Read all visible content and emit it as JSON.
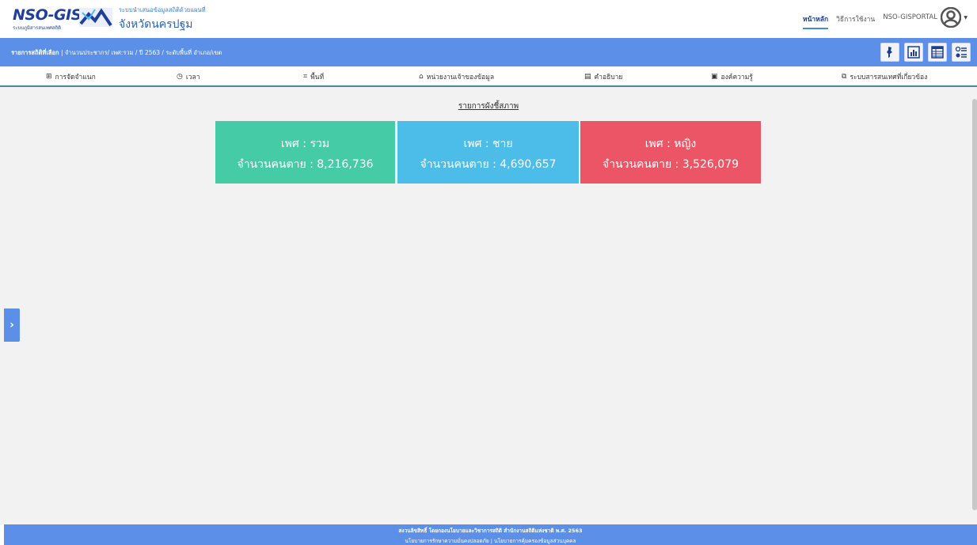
{
  "header": {
    "logo_text": "NSO-GIS",
    "logo_subtext": "ระบบภูมิสารสนเทศสถิติ",
    "site_subtitle": "ระบบนำเสนอข้อมูลสถิติด้วยแผนที่",
    "site_title": "จังหวัดนครปฐม",
    "nav": [
      "หน้าหลัก",
      "วิธีการใช้งาน",
      "NSO-GISPORTAL"
    ],
    "active_nav": "หน้าหลัก"
  },
  "breadcrumb": {
    "label": "รายการสถิติที่เลือก",
    "path": " | จำนวนประชากร/ เพศ:รวม / ปี 2563 / ระดับพื้นที่ อำเภอ/เขต"
  },
  "view_buttons": [
    "map-view-icon",
    "chart-view-icon",
    "table-view-icon",
    "list-view-icon"
  ],
  "menu": [
    {
      "label": "การจัดจำแนก",
      "icon": "sitemap-icon"
    },
    {
      "label": "เวลา",
      "icon": "clock-icon"
    },
    {
      "label": "พื้นที่",
      "icon": "area-icon"
    },
    {
      "label": "หน่วยงานเจ้าของข้อมูล",
      "icon": "institution-icon"
    },
    {
      "label": "คำอธิบาย",
      "icon": "description-icon"
    },
    {
      "label": "องค์ความรู้",
      "icon": "knowledge-icon"
    },
    {
      "label": "ระบบสารสนเทศที่เกี่ยวข้อง",
      "icon": "related-systems-icon"
    }
  ],
  "main": {
    "section_title": "รายการผังชี้สภาพ",
    "cards": [
      {
        "line1": "เพศ : รวม",
        "line2": "จำนวนคนตาย : 8,216,736",
        "color": "#45cba6"
      },
      {
        "line1": "เพศ : ชาย",
        "line2": "จำนวนคนตาย : 4,690,657",
        "color": "#4cbde8"
      },
      {
        "line1": "เพศ : หญิง",
        "line2": "จำนวนคนตาย : 3,526,079",
        "color": "#ec5565"
      }
    ]
  },
  "footer": {
    "line1": "สงวนลิขสิทธิ์ โดยกองนโยบายและวิชาการสถิติ สำนักงานสถิติแห่งชาติ พ.ศ. 2563",
    "line2": "นโยบายการรักษาความมั่นคงปลอดภัย | นโยบายการคุ้มครองข้อมูลส่วนบุคคล"
  },
  "colors": {
    "accent_blue": "#5b8fe8",
    "brand_navy": "#1f3f9a",
    "background": "#f2f2f2"
  }
}
